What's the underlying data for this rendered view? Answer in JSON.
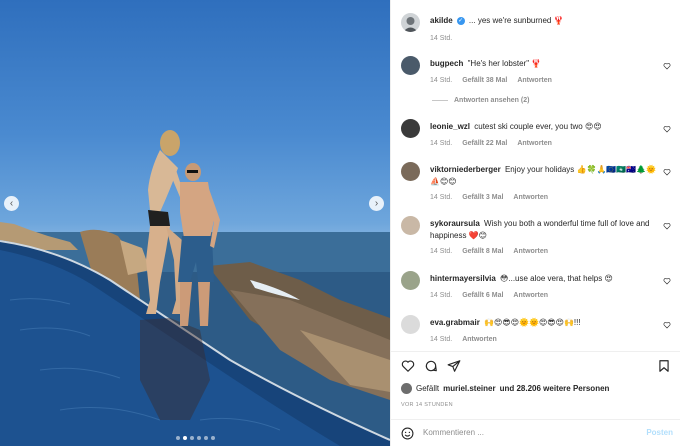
{
  "photo": {
    "prev_icon": "chevron-left-icon",
    "next_icon": "chevron-right-icon",
    "carousel": {
      "count": 6,
      "active": 2
    }
  },
  "caption": {
    "user": "akilde",
    "verified_icon": "verified-badge-icon",
    "text": "... yes we're sunburned 🦞",
    "time": "14 Std."
  },
  "comments": [
    {
      "user": "bugpech",
      "text": "\"He's her lobster\" 🦞",
      "time": "14 Std.",
      "likes": "Gefällt 38 Mal",
      "reply": "Antworten",
      "avatar_color": "#4a5a6a"
    },
    {
      "user": "leonie_wzl",
      "text": "cutest ski couple ever, you two 😍😍",
      "time": "14 Std.",
      "likes": "Gefällt 22 Mal",
      "reply": "Antworten",
      "avatar_color": "#3a3a3a"
    },
    {
      "user": "viktorniederberger",
      "text": "Enjoy your holidays 👍🍀🙏🇪🇺🇲🇴🇦🇺🌲🌞⛵😊😊",
      "time": "14 Std.",
      "likes": "Gefällt 3 Mal",
      "reply": "Antworten",
      "avatar_color": "#7a6a5a"
    },
    {
      "user": "sykoraursula",
      "text": "Wish you both a wonderful time full of love and happiness ❤️😊",
      "time": "14 Std.",
      "likes": "Gefällt 8 Mal",
      "reply": "Antworten",
      "avatar_color": "#c9b8a6"
    },
    {
      "user": "hintermayersilvia",
      "text": "😳...use aloe vera, that helps 😍",
      "time": "14 Std.",
      "likes": "Gefällt 6 Mal",
      "reply": "Antworten",
      "avatar_color": "#9aa38a"
    },
    {
      "user": "eva.grabmair",
      "text": "🙌😍😎😍🌞🌞😍😎😍🙌!!!",
      "time": "14 Std.",
      "likes": "",
      "reply": "Antworten",
      "avatar_color": "#dbdbdb"
    }
  ],
  "view_replies": "Antworten ansehen (2)",
  "actions": {
    "like_icon": "heart-icon",
    "comment_icon": "comment-icon",
    "share_icon": "paper-plane-icon",
    "save_icon": "bookmark-icon"
  },
  "likes": {
    "prefix": "Gefällt",
    "user": "muriel.steiner",
    "suffix": "und 28.206 weitere Personen"
  },
  "posted": "VOR 14 STUNDEN",
  "add_comment": {
    "emoji_icon": "smiley-icon",
    "placeholder": "Kommentieren ...",
    "post_label": "Posten"
  },
  "colors": {
    "link_blue": "#3897f0",
    "post_disabled": "#b2dffc",
    "heart_red": "#ed4956"
  }
}
